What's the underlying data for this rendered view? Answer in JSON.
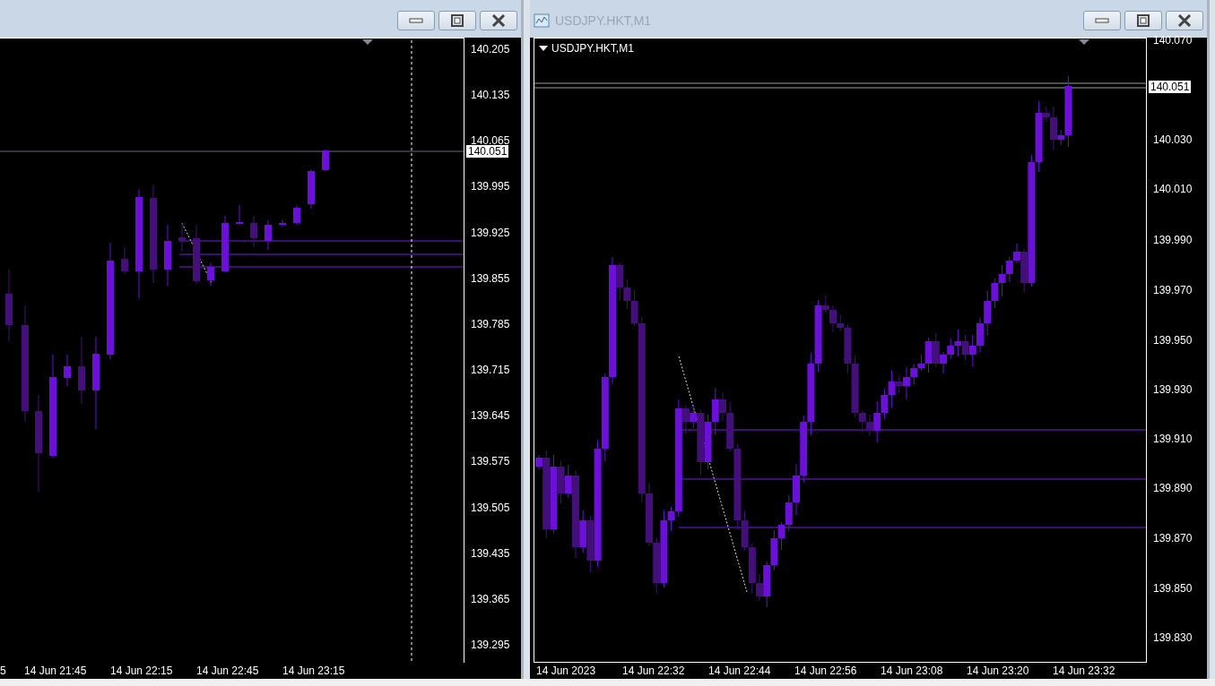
{
  "windows": [
    {
      "price_ticks": [
        "140.205",
        "140.135",
        "140.065",
        "139.995",
        "139.925",
        "139.855",
        "139.785",
        "139.715",
        "139.645",
        "139.575",
        "139.505",
        "139.435",
        "139.365",
        "139.295"
      ],
      "current_price": "140.051",
      "time_labels": [
        "5",
        "14 Jun 21:45",
        "14 Jun 22:15",
        "14 Jun 22:45",
        "14 Jun 23:15"
      ]
    },
    {
      "title": "USDJPY.HKT,M1",
      "symbol_label": "USDJPY.HKT,M1",
      "price_ticks": [
        "140.070",
        "140.030",
        "140.010",
        "139.990",
        "139.970",
        "139.950",
        "139.930",
        "139.910",
        "139.890",
        "139.870",
        "139.850",
        "139.830"
      ],
      "current_price": "140.051",
      "time_labels": [
        "14 Jun 2023",
        "14 Jun 22:32",
        "14 Jun 22:44",
        "14 Jun 22:56",
        "14 Jun 23:08",
        "14 Jun 23:20",
        "14 Jun 23:32"
      ]
    }
  ]
}
